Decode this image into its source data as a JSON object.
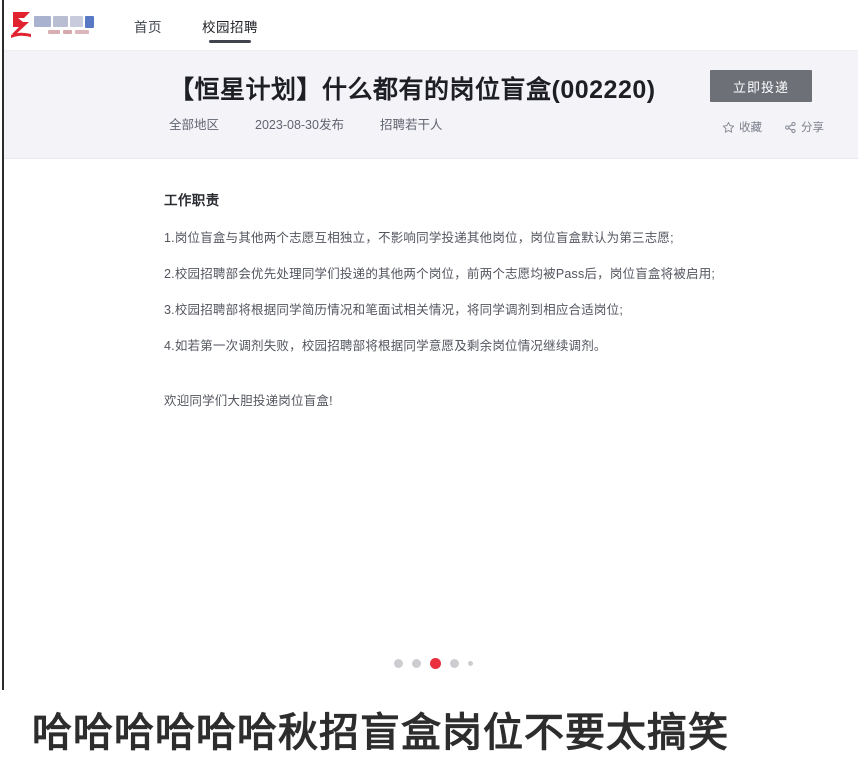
{
  "nav": {
    "brand_logo_alt": "company-logo",
    "links": [
      {
        "label": "首页",
        "active": false
      },
      {
        "label": "校园招聘",
        "active": true
      }
    ]
  },
  "job_header": {
    "title": "【恒星计划】什么都有的岗位盲盒(002220)",
    "meta": [
      "全部地区",
      "2023-08-30发布",
      "招聘若干人"
    ],
    "apply_label": "立即投递",
    "actions": [
      {
        "label": "收藏",
        "icon": "star-icon"
      },
      {
        "label": "分享",
        "icon": "share-icon"
      }
    ]
  },
  "job_body": {
    "section_heading": "工作职责",
    "lines": [
      "1.岗位盲盒与其他两个志愿互相独立，不影响同学投递其他岗位，岗位盲盒默认为第三志愿;",
      "2.校园招聘部会优先处理同学们投递的其他两个岗位，前两个志愿均被Pass后，岗位盲盒将被启用;",
      "3.校园招聘部将根据同学简历情况和笔面试相关情况，将同学调剂到相应合适岗位;",
      "4.如若第一次调剂失败，校园招聘部将根据同学意愿及剩余岗位情况继续调剂。"
    ],
    "closing": "欢迎同学们大胆投递岗位盲盒!"
  },
  "carousel": {
    "dots": [
      {
        "size": "s-md",
        "active": false
      },
      {
        "size": "s-md",
        "active": false
      },
      {
        "size": "s-lg",
        "active": true
      },
      {
        "size": "s-md",
        "active": false
      },
      {
        "size": "s-sm",
        "active": false
      }
    ]
  },
  "caption": {
    "text": "哈哈哈哈哈哈秋招盲盒岗位不要太搞笑"
  },
  "colors": {
    "accent_red": "#ea2f3e",
    "hero_bg": "#f4f4f8",
    "apply_bg": "#6e7078",
    "text_dark": "#1d1f24",
    "text_body": "#53565f"
  }
}
